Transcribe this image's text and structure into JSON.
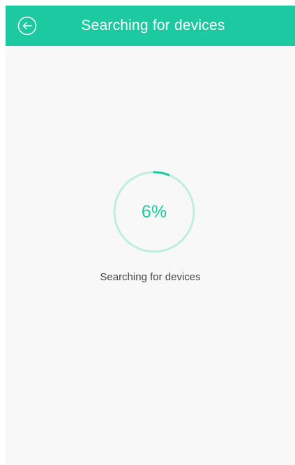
{
  "header": {
    "title": "Searching for devices",
    "back_icon": "arrow-left-circle-icon"
  },
  "progress": {
    "label": "6%",
    "fraction": 0.06
  },
  "status": {
    "text": "Searching for devices"
  },
  "colors": {
    "accent": "#1cc9a0",
    "ring_track": "#bdeee0",
    "background": "#f8f8f8",
    "text": "#444444"
  }
}
